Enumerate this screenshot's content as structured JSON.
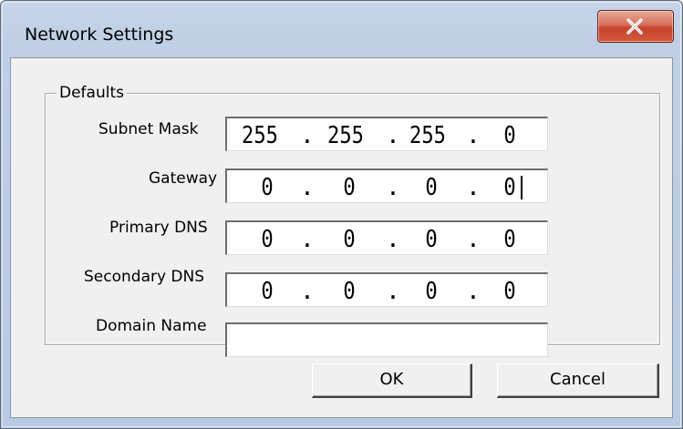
{
  "window": {
    "title": "Network Settings",
    "close_icon": "close-x-icon"
  },
  "defaults": {
    "group_label": "Defaults",
    "subnet_mask": {
      "label": "Subnet Mask",
      "octets": [
        "255",
        "255",
        "255",
        "0"
      ]
    },
    "gateway": {
      "label": "Gateway",
      "octets": [
        "0",
        "0",
        "0",
        "0"
      ]
    },
    "primary_dns": {
      "label": "Primary DNS",
      "octets": [
        "0",
        "0",
        "0",
        "0"
      ]
    },
    "secondary_dns": {
      "label": "Secondary DNS",
      "octets": [
        "0",
        "0",
        "0",
        "0"
      ]
    },
    "domain_name": {
      "label": "Domain Name",
      "value": ""
    }
  },
  "buttons": {
    "ok_label": "OK",
    "cancel_label": "Cancel"
  },
  "colors": {
    "close_button": "#c7442b",
    "dialog_face": "#f0f0f0",
    "window_frame": "#bfd0e6"
  }
}
